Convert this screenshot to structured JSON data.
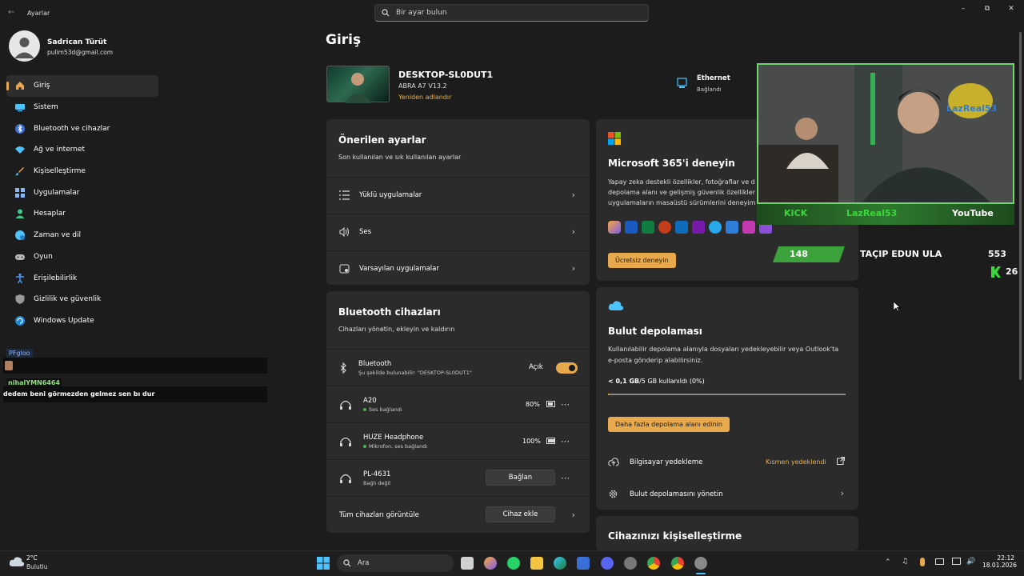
{
  "window": {
    "title": "Ayarlar"
  },
  "search": {
    "placeholder": "Bir ayar bulun"
  },
  "profile": {
    "name": "Sadrican Türüt",
    "email": "pulim53d@gmail.com"
  },
  "sidebar": {
    "items": [
      {
        "label": "Giriş",
        "icon": "home-icon",
        "color": "#e8a84c"
      },
      {
        "label": "Sistem",
        "icon": "system-icon",
        "color": "#4cc2ff"
      },
      {
        "label": "Bluetooth ve cihazlar",
        "icon": "bluetooth-icon",
        "color": "#4c8dff"
      },
      {
        "label": "Ağ ve internet",
        "icon": "network-icon",
        "color": "#4cc2ff"
      },
      {
        "label": "Kişiselleştirme",
        "icon": "brush-icon",
        "color": "#f0a04c"
      },
      {
        "label": "Uygulamalar",
        "icon": "apps-icon",
        "color": "#8ab4f8"
      },
      {
        "label": "Hesaplar",
        "icon": "account-icon",
        "color": "#3fc98a"
      },
      {
        "label": "Zaman ve dil",
        "icon": "globe-icon",
        "color": "#4cc2ff"
      },
      {
        "label": "Oyun",
        "icon": "gamepad-icon",
        "color": "#bbbbbb"
      },
      {
        "label": "Erişilebilirlik",
        "icon": "accessibility-icon",
        "color": "#4c9bff"
      },
      {
        "label": "Gizlilik ve güvenlik",
        "icon": "shield-icon",
        "color": "#999999"
      },
      {
        "label": "Windows Update",
        "icon": "update-icon",
        "color": "#4cc2ff"
      }
    ]
  },
  "chat": {
    "tag": "PFgloo",
    "user": "nihalYMN6464",
    "message": "dedem beni görmezden gelmez sen bı dur"
  },
  "main": {
    "title": "Giriş",
    "device": {
      "name": "DESKTOP-SL0DUT1",
      "model": "ABRA A7 V13.2",
      "rename": "Yeniden adlandır"
    },
    "network": {
      "label": "Ethernet",
      "status": "Bağlandı"
    }
  },
  "recommended": {
    "title": "Önerilen ayarlar",
    "subtitle": "Son kullanılan ve sık kullanılan ayarlar",
    "rows": [
      "Yüklü uygulamalar",
      "Ses",
      "Varsayılan uygulamalar"
    ]
  },
  "bluetooth": {
    "title": "Bluetooth cihazları",
    "subtitle": "Cihazları yönetin, ekleyin ve kaldırın",
    "toggle_label": "Bluetooth",
    "toggle_sub": "Şu şekilde bulunabilir: \"DESKTOP-SL0DUT1\"",
    "toggle_state": "Açık",
    "devices": [
      {
        "name": "A20",
        "status": "Ses bağlandı",
        "battery": "80%"
      },
      {
        "name": "HUZE Headphone",
        "status": "Mikrofon, ses bağlandı",
        "battery": "100%"
      },
      {
        "name": "PL-4631",
        "status": "Bağlı değil",
        "action": "Bağlan"
      }
    ],
    "view_all": "Tüm cihazları görüntüle",
    "add_device": "Cihaz ekle"
  },
  "m365": {
    "title": "Microsoft 365'i deneyin",
    "body_lines": [
      "Yapay zeka destekli özellikler, fotoğraflar ve d",
      "depolama alanı ve gelişmiş güvenlik özellikler",
      "uygulamaların masaüstü sürümlerini deneyim"
    ],
    "cta": "Ücretsiz deneyin"
  },
  "cloud": {
    "title": "Bulut depolaması",
    "body_lines": [
      "Kullanılabilir depolama alanıyla dosyaları yedekleyebilir veya Outlook'ta",
      "e-posta gönderip alabilirsiniz."
    ],
    "usage_bold": "< 0,1 GB",
    "usage_rest": "/5 GB kullanıldı (0%)",
    "cta": "Daha fazla depolama alanı edinin",
    "backup_label": "Bilgisayar yedekleme",
    "backup_status": "Kısmen yedeklendi",
    "manage_label": "Bulut depolamasını yönetin"
  },
  "personalize": {
    "title": "Cihazınızı kişiselleştirme"
  },
  "stream": {
    "kick": "KICK",
    "channel": "LazReal53",
    "youtube": "YouTube",
    "bar_num": "148",
    "bar_text": "TAÇIP EDUN ULA",
    "count": "553",
    "kick_count": "26",
    "badge": "LazReal53"
  },
  "taskbar": {
    "weather_temp": "2°C",
    "weather_desc": "Bulutlu",
    "search": "Ara",
    "time": "22:12",
    "date": "18.01.2026"
  },
  "colors": {
    "accent": "#e8a84c",
    "card": "#2b2b2b",
    "bg": "#1c1c1c"
  }
}
